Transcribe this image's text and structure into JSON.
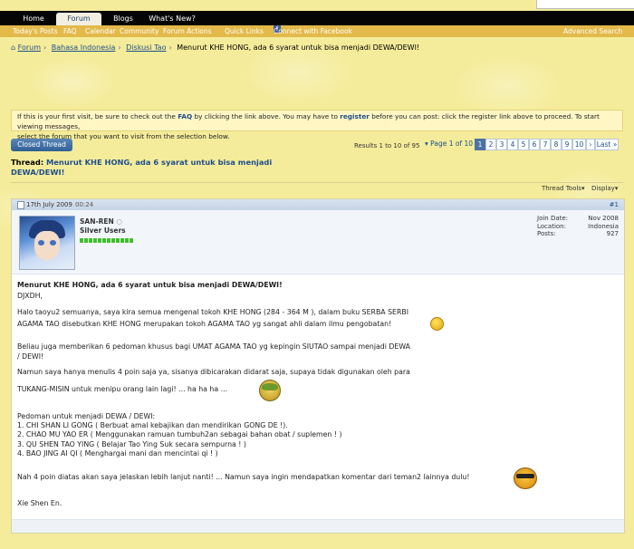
{
  "navbar": {
    "tabs": [
      "Home",
      "Forum",
      "Blogs",
      "What's New?"
    ]
  },
  "subnav": {
    "items": [
      "Today's Posts",
      "FAQ",
      "Calendar",
      "Community",
      "Forum Actions",
      "Quick Links",
      "Connect with Facebook"
    ],
    "advanced_search": "Advanced Search"
  },
  "breadcrumb": {
    "items": [
      "Forum",
      "Bahasa Indonesia",
      "Diskusi Tao",
      "Menurut KHE HONG, ada 6 syarat untuk bisa menjadi DEWA/DEWI!"
    ]
  },
  "notice": {
    "before_faq": "If this is your first visit, be sure to check out the ",
    "faq": "FAQ",
    "after_faq": " by clicking the link above. You may have to ",
    "register": "register",
    "after_register": " before you can post: click the register link above to proceed. To start viewing messages,",
    "line2": "select the forum that you want to visit from the selection below."
  },
  "thread_controls": {
    "closed_button": "Closed Thread",
    "results": "Results 1 to 10 of 95",
    "page_of": "Page 1 of 10",
    "pages": [
      "1",
      "2",
      "3",
      "4",
      "5",
      "6",
      "7",
      "8",
      "9",
      "10"
    ],
    "current_page": "1",
    "last": "Last",
    "thread_tools": "Thread Tools",
    "display": "Display"
  },
  "thread": {
    "prefix": "Thread:",
    "title": "Menurut KHE HONG, ada 6 syarat untuk bisa menjadi DEWA/DEWI!"
  },
  "post": {
    "date": "17th July 2009",
    "time": "00:24",
    "number": "#1",
    "user": {
      "name": "SAN-REN",
      "title": "Silver Users"
    },
    "details": {
      "labels": [
        "Join Date:",
        "Location:",
        "Posts:"
      ],
      "values": [
        "Nov 2008",
        "Indonesia",
        "927"
      ]
    },
    "lines": [
      "Menurut KHE HONG, ada 6 syarat untuk bisa menjadi DEWA/DEWI!",
      "DJXDH,",
      "Halo taoyu2 semuanya, saya kira semua mengenal tokoh KHE HONG (284 - 364 M ), dalam buku SERBA SERBI",
      "AGAMA TAO disebutkan KHE HONG merupakan tokoh AGAMA TAO yg sangat ahli dalam ilmu pengobatan!",
      "Beliau juga memberikan 6 pedoman khusus bagi UMAT AGAMA TAO yg kepingin SIUTAO sampai menjadi DEWA",
      "/ DEWI!",
      "Namun saya hanya menulis 4 poin saja ya, sisanya dibicarakan didarat saja, supaya tidak digunakan oleh para",
      "TUKANG-MISIN untuk menipu orang lain lagi! ... ha ha ha ...",
      "Pedoman untuk menjadi DEWA / DEWI:",
      "1. CHI SHAN LI GONG ( Berbuat amal kebajikan dan mendirikan GONG DE !).",
      "2. CHAO MU YAO ER ( Menggunakan ramuan tumbuh2an sebagai bahan obat / suplemen ! )",
      "3. QU SHEN TAO YING ( Belajar Tao Ying Suk secara sempurna ! )",
      "4. BAO JING AI QI ( Menghargai mani dan mencintai qi ! )",
      "Nah 4 poin diatas akan saya jelaskan lebih lanjut nanti! ... Namun saya ingin mendapatkan komentar dari teman2 lainnya dulu!",
      "Xie Shen En."
    ]
  }
}
